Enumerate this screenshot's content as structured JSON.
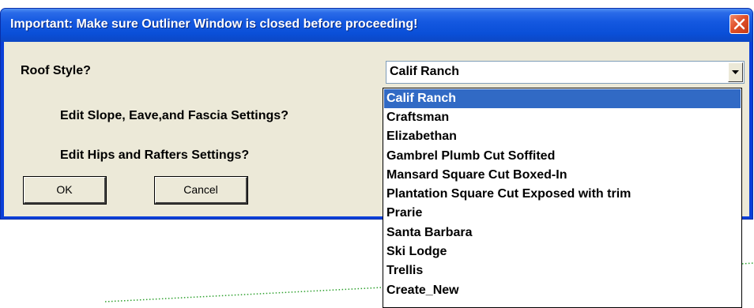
{
  "window": {
    "title": "Important:  Make sure Outliner Window is closed before proceeding!"
  },
  "form": {
    "roof_style_label": "Roof Style?",
    "slope_label": "Edit  Slope, Eave,and Fascia Settings?",
    "hips_label": "Edit  Hips and Rafters Settings?",
    "roof_style_value": "Calif Ranch"
  },
  "buttons": {
    "ok_label": "OK",
    "cancel_label": "Cancel"
  },
  "dropdown": {
    "selected_index": 0,
    "options": [
      "Calif Ranch",
      "Craftsman",
      "Elizabethan",
      "Gambrel  Plumb Cut Soffited",
      "Mansard  Square Cut Boxed-In",
      "Plantation Square Cut Exposed with trim",
      "Prarie",
      "Santa Barbara",
      "Ski Lodge",
      "Trellis",
      "Create_New"
    ]
  },
  "icons": {
    "close": "close-icon",
    "dropdown_arrow": "chevron-down-icon"
  },
  "colors": {
    "titlebar": "#0a4fd8",
    "dialog_face": "#ece9d8",
    "selection": "#316ac5",
    "close_button": "#e0502a",
    "guide_line": "#2ca02c"
  }
}
